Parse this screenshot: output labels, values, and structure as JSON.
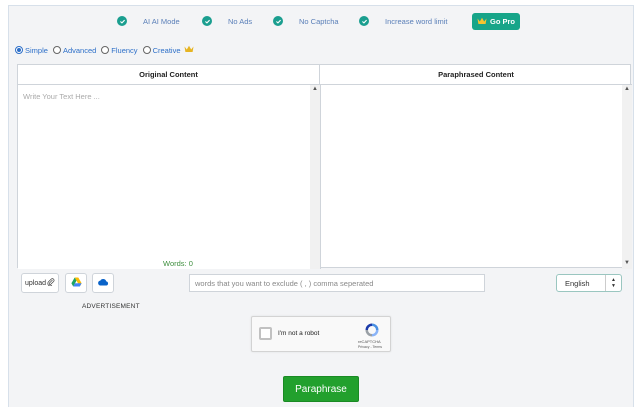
{
  "features": [
    {
      "label": "AI AI Mode"
    },
    {
      "label": "No Ads"
    },
    {
      "label": "No Captcha"
    },
    {
      "label": "Increase word limit"
    }
  ],
  "gopro_label": "Go Pro",
  "modes": [
    {
      "label": "Simple",
      "selected": true
    },
    {
      "label": "Advanced",
      "selected": false
    },
    {
      "label": "Fluency",
      "selected": false
    },
    {
      "label": "Creative",
      "selected": false
    }
  ],
  "panels": {
    "original_title": "Original Content",
    "paraphrased_title": "Paraphrased Content",
    "input_placeholder": "Write Your Text Here ...",
    "words_label": "Words: 0"
  },
  "toolbar": {
    "upload_label": "upload",
    "exclude_placeholder": "words that you want to exclude ( , ) comma seperated",
    "language": "English"
  },
  "advertisement": "ADVERTISEMENT",
  "captcha": {
    "label": "I'm not a robot",
    "brand": "reCAPTCHA",
    "terms": "Privacy - Terms"
  },
  "paraphrase_label": "Paraphrase",
  "colors": {
    "accent_teal": "#17a589",
    "link_blue": "#2d6fc8",
    "button_green": "#22a02d"
  }
}
